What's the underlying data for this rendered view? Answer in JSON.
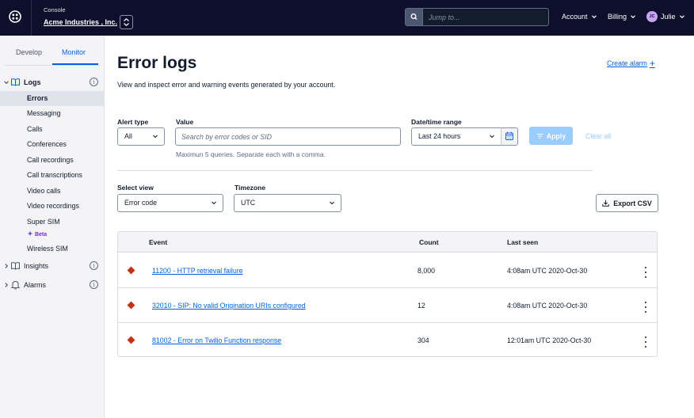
{
  "topbar": {
    "console_label": "Console",
    "account_name": "Acme Industries , Inc.",
    "search_placeholder": "Jump to...",
    "account_menu": "Account",
    "billing_menu": "Billing",
    "user_initials": "JC",
    "user_name": "Julie",
    "background_color": "#0d0f2b"
  },
  "sidebar": {
    "tabs": [
      {
        "label": "Develop",
        "active": false
      },
      {
        "label": "Monitor",
        "active": true
      }
    ],
    "groups": {
      "logs": "Logs",
      "insights": "Insights",
      "alarms": "Alarms"
    },
    "log_items": [
      {
        "label": "Errors",
        "active": true
      },
      {
        "label": "Messaging"
      },
      {
        "label": "Calls"
      },
      {
        "label": "Conferences"
      },
      {
        "label": "Call recordings"
      },
      {
        "label": "Call transcriptions"
      },
      {
        "label": "Video calls"
      },
      {
        "label": "Video recordings"
      },
      {
        "label": "Super SIM"
      },
      {
        "label": "Wireless SIM"
      }
    ],
    "beta_badge": "Beta"
  },
  "main": {
    "title": "Error logs",
    "description": "View and inspect error and warning events generated by your account.",
    "create_alarm": "Create alarm",
    "filters": {
      "alert_type_label": "Alert type",
      "alert_type_value": "All",
      "value_label": "Value",
      "value_placeholder": "Search by error codes or SID",
      "value_help": "Maximun 5 queries. Separate each with a comma.",
      "date_range_label": "Date/time range",
      "date_range_value": "Last 24 hours",
      "apply": "Apply",
      "clear_all": "Clear all"
    },
    "view": {
      "select_view_label": "Select view",
      "select_view_value": "Error code",
      "timezone_label": "Timezone",
      "timezone_value": "UTC",
      "export": "Export CSV"
    },
    "table": {
      "headers": {
        "event": "Event",
        "count": "Count",
        "last_seen": "Last seen"
      },
      "rows": [
        {
          "event": "11200 - HTTP retrieval failure",
          "count": "8,000",
          "last_seen": "4:08am UTC 2020-Oct-30"
        },
        {
          "event": "32010 - SIP: No valid Origination URIs configured",
          "count": "12",
          "last_seen": "4:08am UTC 2020-Oct-30"
        },
        {
          "event": "81002 - Error on Twilio Function response",
          "count": "304",
          "last_seen": "12:01am UTC 2020-Oct-30"
        }
      ]
    }
  },
  "colors": {
    "accent": "#0263e0",
    "error": "#c1331c",
    "apply_disabled": "#99cdff"
  }
}
